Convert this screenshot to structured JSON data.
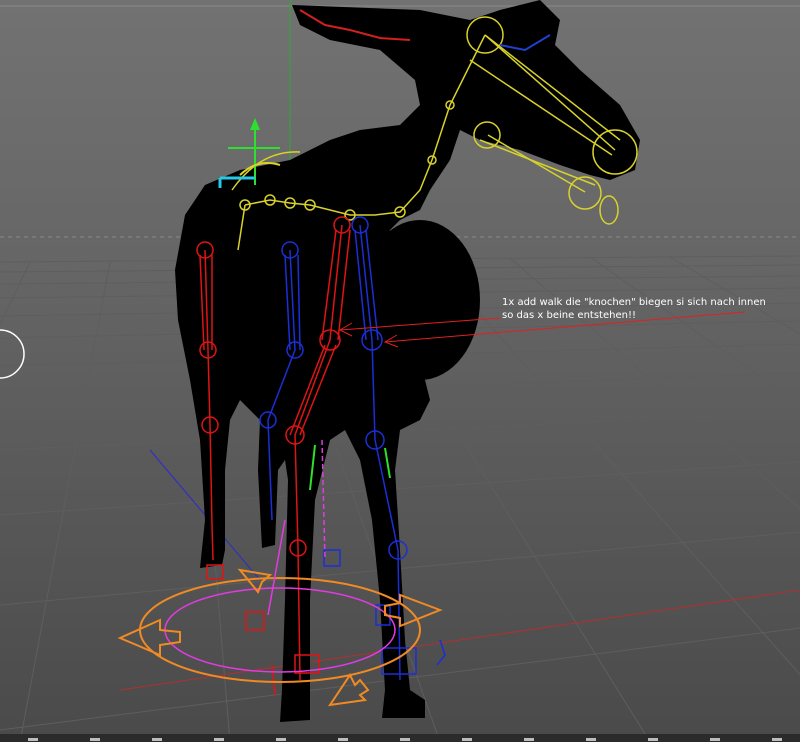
{
  "viewport": {
    "annotation": "1x add walk  die \"knochen\" biegen si sich nach innen so das x beine entstehen!!"
  },
  "colors": {
    "background_top": "#6e6e6e",
    "background_bottom": "#4a4a4a",
    "grid": "#5c5c5c",
    "silhouette": "#000000",
    "bone_left": "#e01414",
    "bone_right": "#1b2fd6",
    "bone_spine": "#d8d22a",
    "controller_orange": "#f08a24",
    "controller_magenta": "#e23ce0",
    "annotation_arrow": "#e02020"
  },
  "icons": [
    "move-gizmo-icon",
    "walk-controller-icon"
  ]
}
